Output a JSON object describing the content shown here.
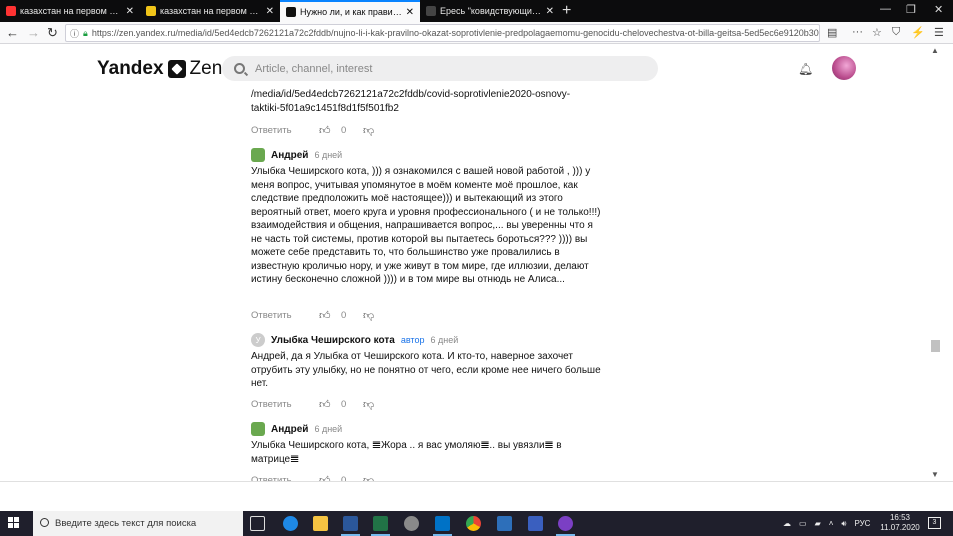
{
  "browser": {
    "tabs": [
      {
        "label": "казахстан на первом месте п",
        "favicon_color": "#ff3333",
        "active": false
      },
      {
        "label": "казахстан на первом месте п",
        "favicon_color": "#f0c419",
        "active": false
      },
      {
        "label": "Нужно ли, и как правильно о",
        "favicon_color": "#111111",
        "active": true
      },
      {
        "label": "Ересь \"ковидствующих\" | Буд",
        "favicon_color": "#444444",
        "active": false
      }
    ],
    "new_tab": "+",
    "url": "https://zen.yandex.ru/media/id/5ed4edcb7262121a72c2fddb/nujno-li-i-kak-pravilno-okazat-soprotivlenie-predpolagaemomu-genocidu-chelovechestva-ot-billa-geitsa-5ed5ec6e9120b30",
    "window_controls": {
      "minimize": "—",
      "restore": "❐",
      "close": "✕"
    }
  },
  "header": {
    "logo_text": "Yandex",
    "logo_suffix": "Zen",
    "search_placeholder": "Article, channel, interest"
  },
  "comments": [
    {
      "id": "c0",
      "text_lines": [
        "/media/id/5ed4edcb7262121a72c2fddb/covid-soprotivlenie2020-osnovy-",
        "taktiki-5f01a9c1451f8d1f5f501fb2"
      ],
      "reply_label": "Ответить",
      "likes": "0"
    },
    {
      "id": "c1",
      "author": "Андрей",
      "time": "6 дней",
      "text": "Улыбка Чеширского кота, ))) я ознакомился с вашей новой работой , ))) у меня вопрос, учитывая упомянутое в моём коменте моё прошлое, как следствие предположить моё настоящее))) и вытекающий из этого вероятный ответ, моего круга и уровня профессионального ( и не только!!!) взаимодействия и общения, напрашивается вопрос,... вы уверенны что я не часть той системы, против которой вы пытаетесь бороться??? )))) вы можете себе представить то, что большинство уже провалились в известную кроличью нору, и уже живут в том мире, где иллюзии, делают истину бесконечно сложной )))) и в том мире вы отнюдь не Алиса...",
      "reply_label": "Ответить",
      "likes": "0"
    },
    {
      "id": "c2",
      "author": "Улыбка Чеширского кота",
      "avatar_letter": "У",
      "badge": "автор",
      "time": "6 дней",
      "text": "Андрей, да я Улыбка от Чеширского кота. И кто-то, наверное захочет отрубить эту улыбку, но не понятно от чего, если кроме нее ничего больше нет.",
      "reply_label": "Ответить",
      "likes": "0"
    },
    {
      "id": "c3",
      "author": "Андрей",
      "time": "6 дней",
      "text": "Улыбка Чеширского кота, 𝌆Жора .. я вас умоляю𝌆.. вы увязли𝌆 в матрице𝌆",
      "reply_label": "Ответить",
      "likes": "0"
    }
  ],
  "taskbar": {
    "search_placeholder": "Введите здесь текст для поиска",
    "language": "РУС",
    "time": "16:53",
    "date": "11.07.2020",
    "notification_count": "3"
  },
  "colors": {
    "accent": "#0a84ff",
    "author_badge": "#1a73e8",
    "taskbar": "#1f1f2c"
  }
}
